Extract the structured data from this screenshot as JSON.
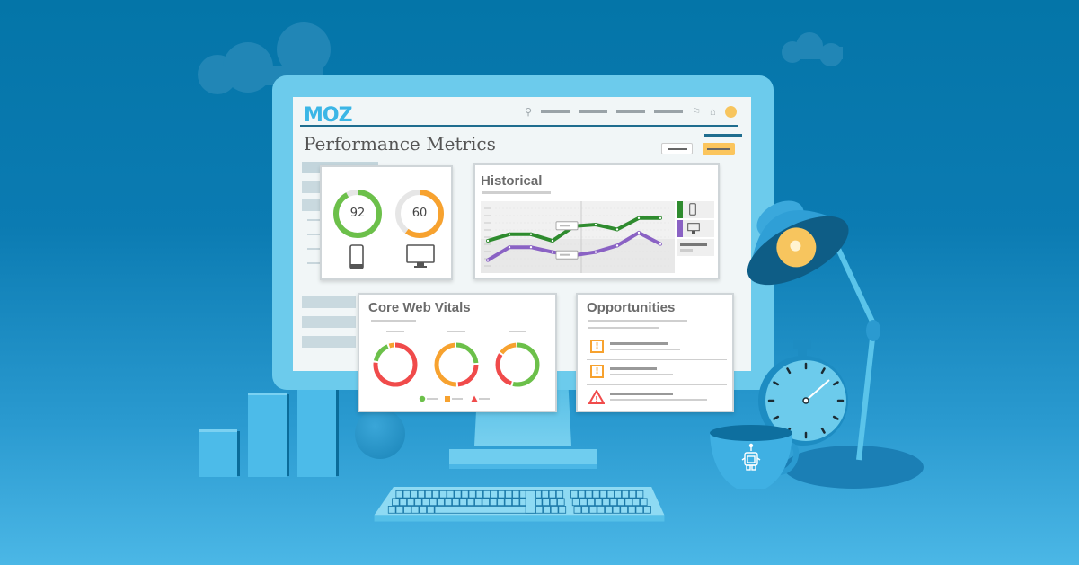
{
  "app": {
    "logo": "MOZ",
    "page_title": "Performance Metrics"
  },
  "nav": {
    "icons": [
      "search-icon",
      "flag-icon",
      "home-icon",
      "avatar"
    ]
  },
  "speed_card": {
    "mobile_score": "92",
    "desktop_score": "60",
    "mobile_fraction": 0.92,
    "desktop_fraction": 0.6,
    "mobile_color": "#6cc04a",
    "desktop_color": "#f7a22f",
    "mobile_icon": "smartphone-icon",
    "desktop_icon": "desktop-monitor-icon"
  },
  "historical": {
    "title": "Historical",
    "series": [
      {
        "name": "mobile",
        "color": "#2e8b2e",
        "values": [
          60,
          64,
          64,
          60,
          69,
          70,
          67,
          74,
          74
        ]
      },
      {
        "name": "desktop",
        "color": "#8a62c4",
        "values": [
          48,
          56,
          56,
          53,
          51,
          53,
          57,
          65,
          58
        ]
      }
    ],
    "legend": [
      {
        "label": "mobile",
        "color": "#2e8b2e",
        "icon": "smartphone-icon"
      },
      {
        "label": "desktop",
        "color": "#8a62c4",
        "icon": "desktop-monitor-icon"
      }
    ]
  },
  "core_web_vitals": {
    "title": "Core Web Vitals",
    "donuts": [
      {
        "segments": [
          {
            "color": "#f04b4b",
            "value": 0.78
          },
          {
            "color": "#6cc04a",
            "value": 0.17
          },
          {
            "color": "#f7a22f",
            "value": 0.05
          }
        ]
      },
      {
        "segments": [
          {
            "color": "#6cc04a",
            "value": 0.25
          },
          {
            "color": "#f04b4b",
            "value": 0.25
          },
          {
            "color": "#f7a22f",
            "value": 0.5
          }
        ]
      },
      {
        "segments": [
          {
            "color": "#6cc04a",
            "value": 0.55
          },
          {
            "color": "#f04b4b",
            "value": 0.3
          },
          {
            "color": "#f7a22f",
            "value": 0.15
          }
        ]
      }
    ],
    "legend": [
      {
        "shape": "circle",
        "color": "#6cc04a"
      },
      {
        "shape": "square",
        "color": "#f7a22f"
      },
      {
        "shape": "triangle",
        "color": "#f04b4b"
      }
    ]
  },
  "opportunities": {
    "title": "Opportunities",
    "items": [
      {
        "icon": "warning-square-icon",
        "color": "#f7a22f",
        "glyph": "!"
      },
      {
        "icon": "warning-square-icon",
        "color": "#f7a22f",
        "glyph": "!"
      },
      {
        "icon": "alert-triangle-icon",
        "color": "#f04b4b",
        "glyph": "!"
      }
    ]
  },
  "decor": {
    "bar_chart_fractions": [
      0.4,
      0.7,
      1.0
    ]
  }
}
